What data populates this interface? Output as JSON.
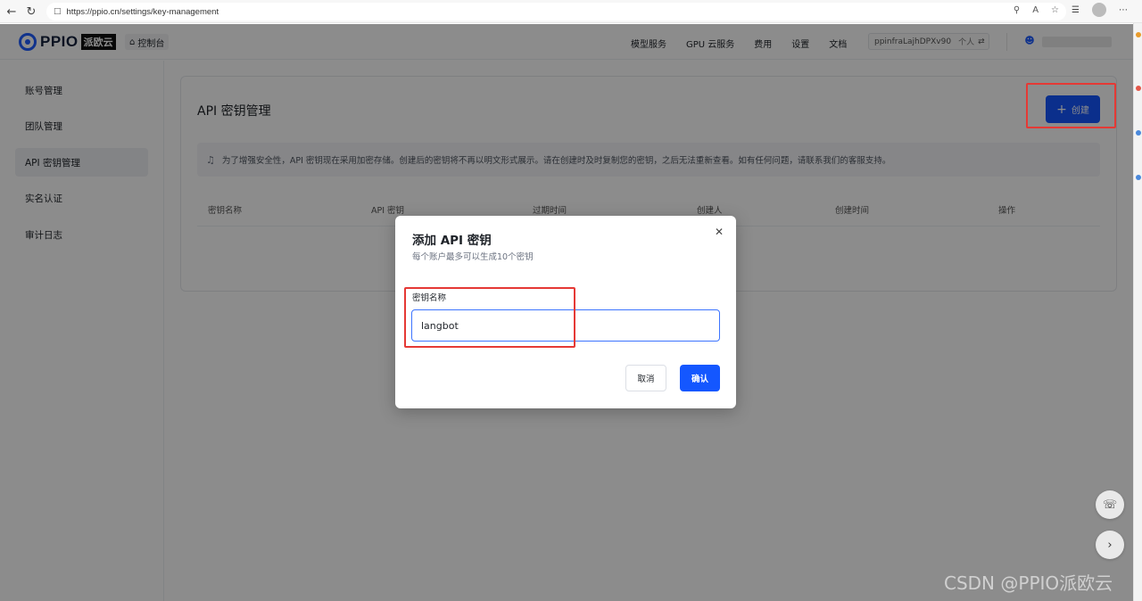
{
  "browser": {
    "url_scheme": "https://",
    "url": "https://ppio.cn/settings/key-management",
    "back_icon": "arrow-left-icon",
    "refresh_icon": "refresh-icon"
  },
  "header": {
    "logo_text": "PPIO",
    "logo_cn": "派欧云",
    "console_label": "控制台",
    "nav": [
      "模型服务",
      "GPU 云服务",
      "费用",
      "设置",
      "文档"
    ],
    "account_id": "ppinfraLajhDPXv90",
    "account_type": "个人"
  },
  "sidebar": {
    "items": [
      {
        "label": "账号管理",
        "active": false
      },
      {
        "label": "团队管理",
        "active": false
      },
      {
        "label": "API 密钥管理",
        "active": true
      },
      {
        "label": "实名认证",
        "active": false
      },
      {
        "label": "审计日志",
        "active": false
      }
    ]
  },
  "main": {
    "title": "API 密钥管理",
    "create_label": "创建",
    "notice": "为了增强安全性，API 密钥现在采用加密存储。创建后的密钥将不再以明文形式展示。请在创建时及时复制您的密钥，之后无法重新查看。如有任何问题，请联系我们的客服支持。",
    "columns": [
      "密钥名称",
      "API 密钥",
      "过期时间",
      "创建人",
      "创建时间",
      "操作"
    ]
  },
  "modal": {
    "title": "添加 API 密钥",
    "subtitle": "每个账户最多可以生成10个密钥",
    "field_label": "密钥名称",
    "field_value": "langbot",
    "cancel_label": "取消",
    "confirm_label": "确认"
  },
  "watermark": "CSDN @PPIO派欧云",
  "colors": {
    "primary": "#1457ff",
    "highlight": "#e53935"
  }
}
